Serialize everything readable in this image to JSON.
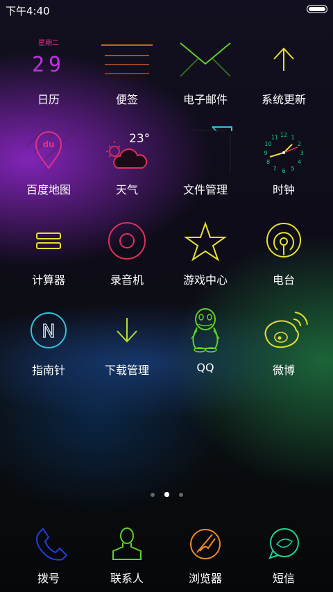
{
  "status": {
    "time": "下午4:40",
    "battery_level": 1.0
  },
  "calendar": {
    "weekday": "星期二",
    "day": "29"
  },
  "weather": {
    "temperature": "23°"
  },
  "clock_numbers": [
    "12",
    "1",
    "2",
    "3",
    "4",
    "5",
    "6",
    "7",
    "8",
    "9",
    "10",
    "11"
  ],
  "apps": [
    {
      "label": "日历"
    },
    {
      "label": "便签"
    },
    {
      "label": "电子邮件"
    },
    {
      "label": "系统更新"
    },
    {
      "label": "百度地图"
    },
    {
      "label": "天气"
    },
    {
      "label": "文件管理"
    },
    {
      "label": "时钟"
    },
    {
      "label": "计算器"
    },
    {
      "label": "录音机"
    },
    {
      "label": "游戏中心"
    },
    {
      "label": "电台"
    },
    {
      "label": "指南针"
    },
    {
      "label": "下载管理"
    },
    {
      "label": "QQ"
    },
    {
      "label": "微博"
    }
  ],
  "pager": {
    "count": 3,
    "active_index": 1
  },
  "dock": [
    {
      "label": "拨号"
    },
    {
      "label": "联系人"
    },
    {
      "label": "浏览器"
    },
    {
      "label": "短信"
    }
  ],
  "colors": {
    "magenta": "#e0308a",
    "orange": "#f08a24",
    "green": "#5fd12a",
    "yellow": "#e8e030",
    "cyan": "#2ec4e0",
    "blue": "#2040e0",
    "teal": "#1fd38e"
  }
}
